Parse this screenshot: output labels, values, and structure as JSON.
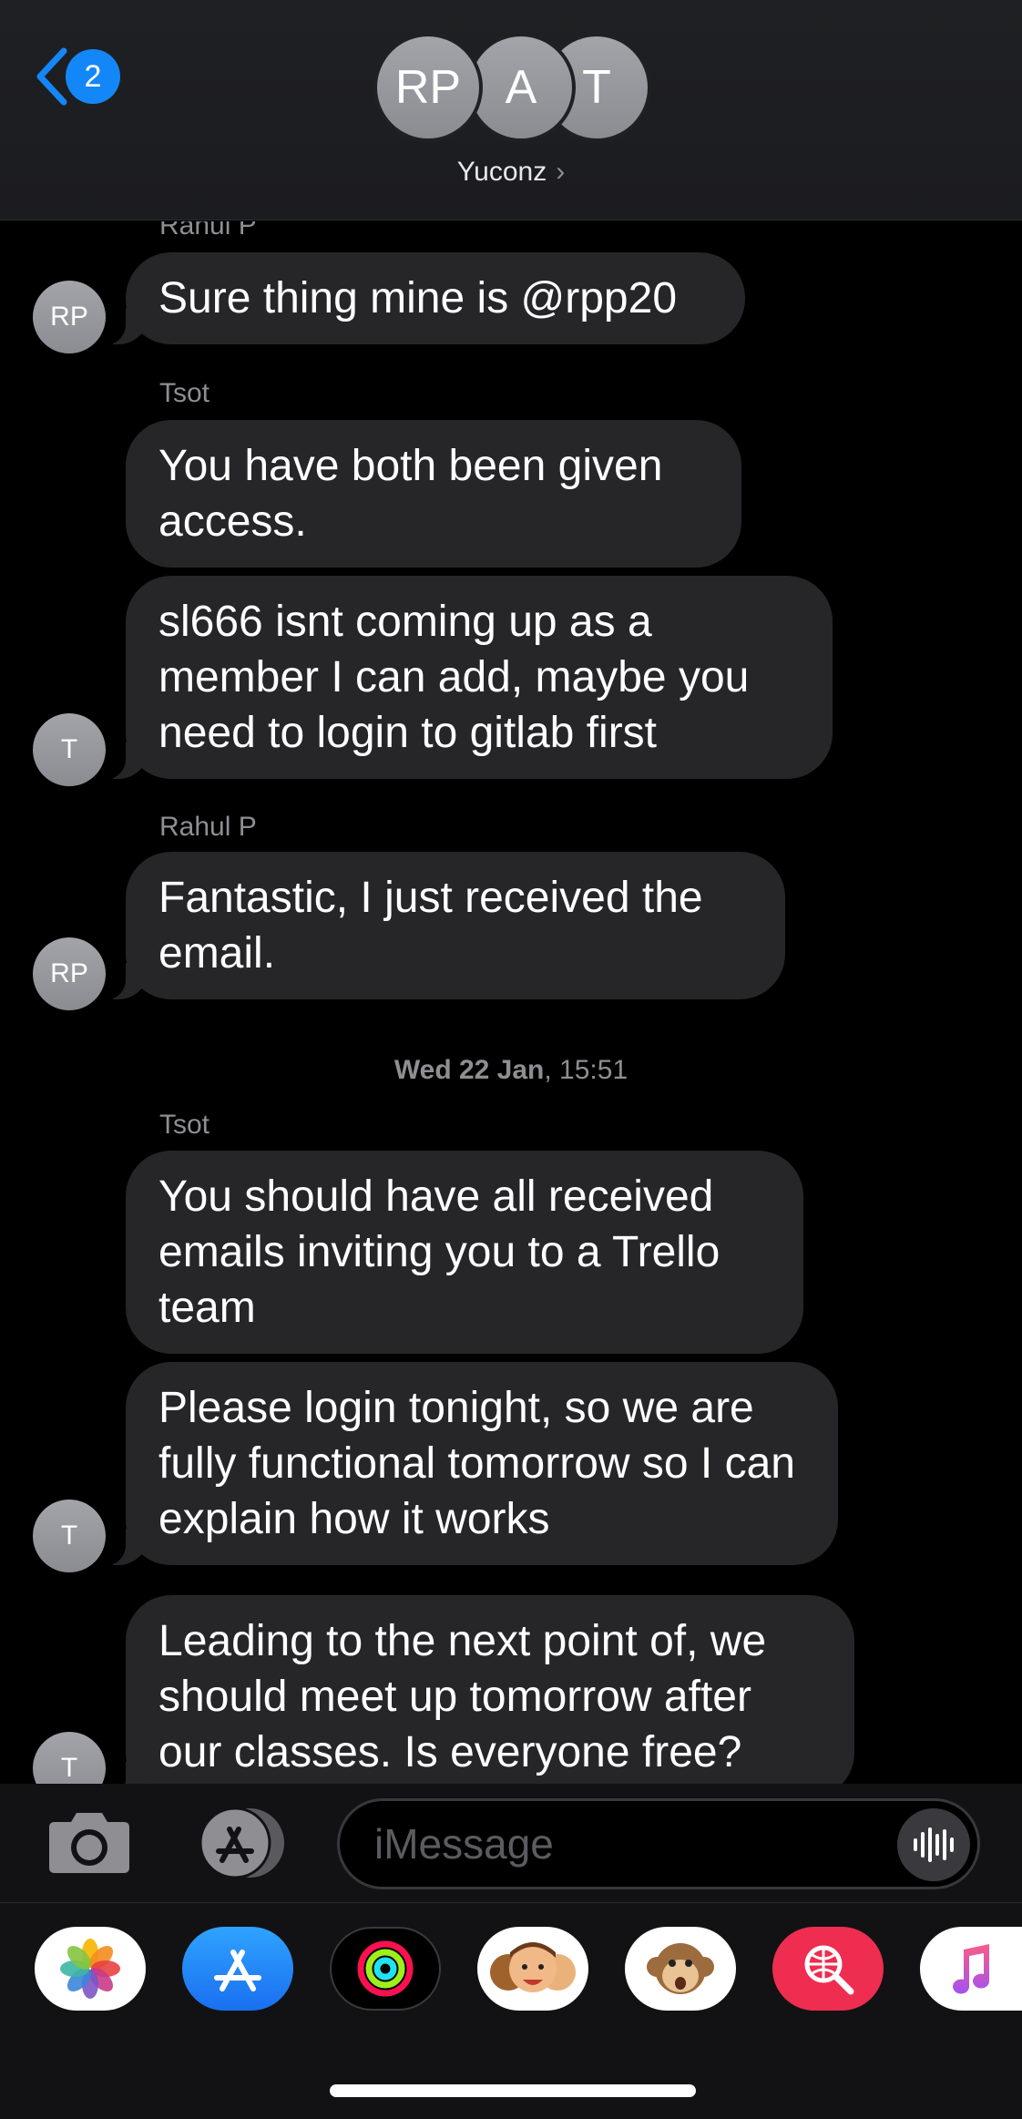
{
  "header": {
    "back_badge": "2",
    "avatars": [
      "RP",
      "A",
      "T"
    ],
    "group_name": "Yuconz"
  },
  "messages": [
    {
      "sender": "Rahul P",
      "avatar": "RP",
      "bubbles": [
        "Sure thing mine is @rpp20"
      ]
    },
    {
      "sender": "Tsot",
      "avatar": "T",
      "bubbles": [
        "You have both been given access.",
        "sl666 isnt coming up as a member I can add, maybe you need to login to gitlab first"
      ]
    },
    {
      "sender": "Rahul P",
      "avatar": "RP",
      "bubbles": [
        "Fantastic, I just received the email."
      ]
    },
    {
      "timestamp_day": "Wed 22 Jan",
      "timestamp_time": ", 15:51"
    },
    {
      "sender": "Tsot",
      "avatar": "T",
      "bubbles": [
        "You should have all received emails inviting you to a Trello team",
        "Please login tonight, so we are fully functional tomorrow so I can explain how it works",
        "Leading to the next point of, we should meet up tomorrow after our classes. Is everyone free?"
      ]
    }
  ],
  "input": {
    "placeholder": "iMessage",
    "value": ""
  },
  "icons": {
    "camera": "camera-icon",
    "app_store": "app-store-icon",
    "mic": "audio-waveform-icon"
  },
  "app_drawer": [
    "Photos",
    "App Store",
    "Activity",
    "Memoji Stickers",
    "Animoji",
    "Images Search",
    "Music"
  ],
  "colors": {
    "accent": "#1487f8",
    "bubble": "#262629",
    "avatar": "#9a9ba1",
    "secondary_text": "#8e8e93"
  }
}
